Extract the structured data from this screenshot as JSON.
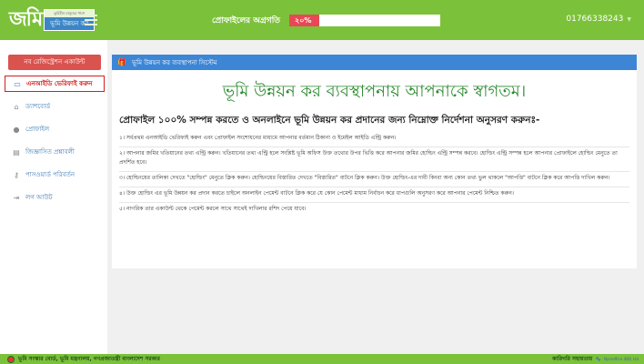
{
  "header": {
    "logo_text": "জমি",
    "logo_tagline": "ভূমিহীন মানুষের পাশে",
    "logo_subtitle": "ভূমি উন্নয়ন কর",
    "menu_icon": "hamburger-icon",
    "progress_label": "প্রোফাইলের অগ্রগতি",
    "progress_percent": 20,
    "progress_text": "২০%",
    "phone": "01766338243",
    "phone_caret_icon": "caret-down-icon"
  },
  "sidebar": {
    "new_account_label": "নব রেজিস্ট্রেশন একাউন্ট",
    "items": [
      {
        "label": "এনআইডি ভেরিফাই করুন",
        "icon": "id-card-icon",
        "active": true
      },
      {
        "label": "ড্যাশবোর্ড",
        "icon": "home-icon",
        "active": false
      },
      {
        "label": "প্রোফাইল",
        "icon": "user-icon",
        "active": false
      },
      {
        "label": "জিজ্ঞাসিত প্রশ্নাবলী",
        "icon": "book-icon",
        "active": false
      },
      {
        "label": "পাসওয়ার্ড পরিবর্তন",
        "icon": "key-icon",
        "active": false
      },
      {
        "label": "লগ আউট",
        "icon": "logout-icon",
        "active": false
      }
    ]
  },
  "main": {
    "panel_title": "ভূমি উন্নয়ন কর ব্যবস্থাপনা সিস্টেম",
    "panel_icon": "gift-icon",
    "welcome": "ভূমি উন্নয়ন কর ব্যবস্থাপনায় আপনাকে স্বাগতম।",
    "instructions_title": "প্রোফাইল ১০০% সম্পন্ন করতে ও অনলাইনে ভূমি উন্নয়ন কর প্রদানের জন্য নিম্নোক্ত নির্দেশনা অনুসরণ করুনঃ-",
    "steps": [
      "১। সর্বপ্রথম এনআইডি ভেরিফাই করুন এবং প্রোফাইল সংশোধনের মাধ্যমে আপনার বর্তমান ঠিকানা ও ইমেইল আইডি এন্ট্রি করুন।",
      "২। আপনার জমির খতিয়ানের তথ্য এন্ট্রি করুন। খতিয়ানের তথ্য এন্ট্রি হলে সংশ্লিষ্ট ভূমি অফিস উক্ত তথ্যের উপর ভিত্তি করে আপনার জমির হোল্ডিং এন্ট্রি সম্পন্ন করবে। হোল্ডিং এন্ট্রি সম্পন্ন হলে আপনার প্রোফাইলে হোল্ডিং মেনুতে তা প্রদর্শিত হবে।",
      "৩। হোল্ডিংয়ের তালিকা দেখতে \"হোল্ডিং\" মেনুতে ক্লিক করুন। হোল্ডিংয়ের বিস্তারিত দেখতে \"বিস্তারিত\" বাটনে ক্লিক করুন। উক্ত হোল্ডিং-এর দাবী কিংবা অন্য কোন তথ্য ভুল থাকলে \"আপত্তি\" বাটনে ক্লিক করে আপত্তি দাখিল করুন।",
      "৪। উক্ত হোল্ডিং এর ভূমি উন্নয়ন কর প্রদান করতে চাইলে অনলাইন পেমেন্ট বাটনে ক্লিক করে যে কোন পেমেন্ট মাধ্যম নির্বাচন করে ধাপগুলি অনুসরণ করে আপনার পেমেন্ট নিশ্চিত করুন।",
      "৫। নাগরিক তার একাউন্ট থেকে পেমেন্ট করলে সাথে সাথেই দাখিলার রশিদ পেয়ে যাবে।"
    ]
  },
  "footer": {
    "left_text": "ভূমি সংস্কার বোর্ড, ভূমি মন্ত্রণালয়, গণপ্রজাতন্ত্রী বাংলাদেশ সরকার",
    "seal_icon": "govt-seal-icon",
    "right_label": "কারিগরি সহায়তায়",
    "right_logo_icon": "company-logo-icon",
    "right_company": "Nymoffice (BD) Ltd"
  },
  "colors": {
    "brand_green": "#7cc13a",
    "panel_blue": "#3d86d6",
    "danger_red": "#d9534f",
    "welcome_green": "#2a8a2e"
  }
}
